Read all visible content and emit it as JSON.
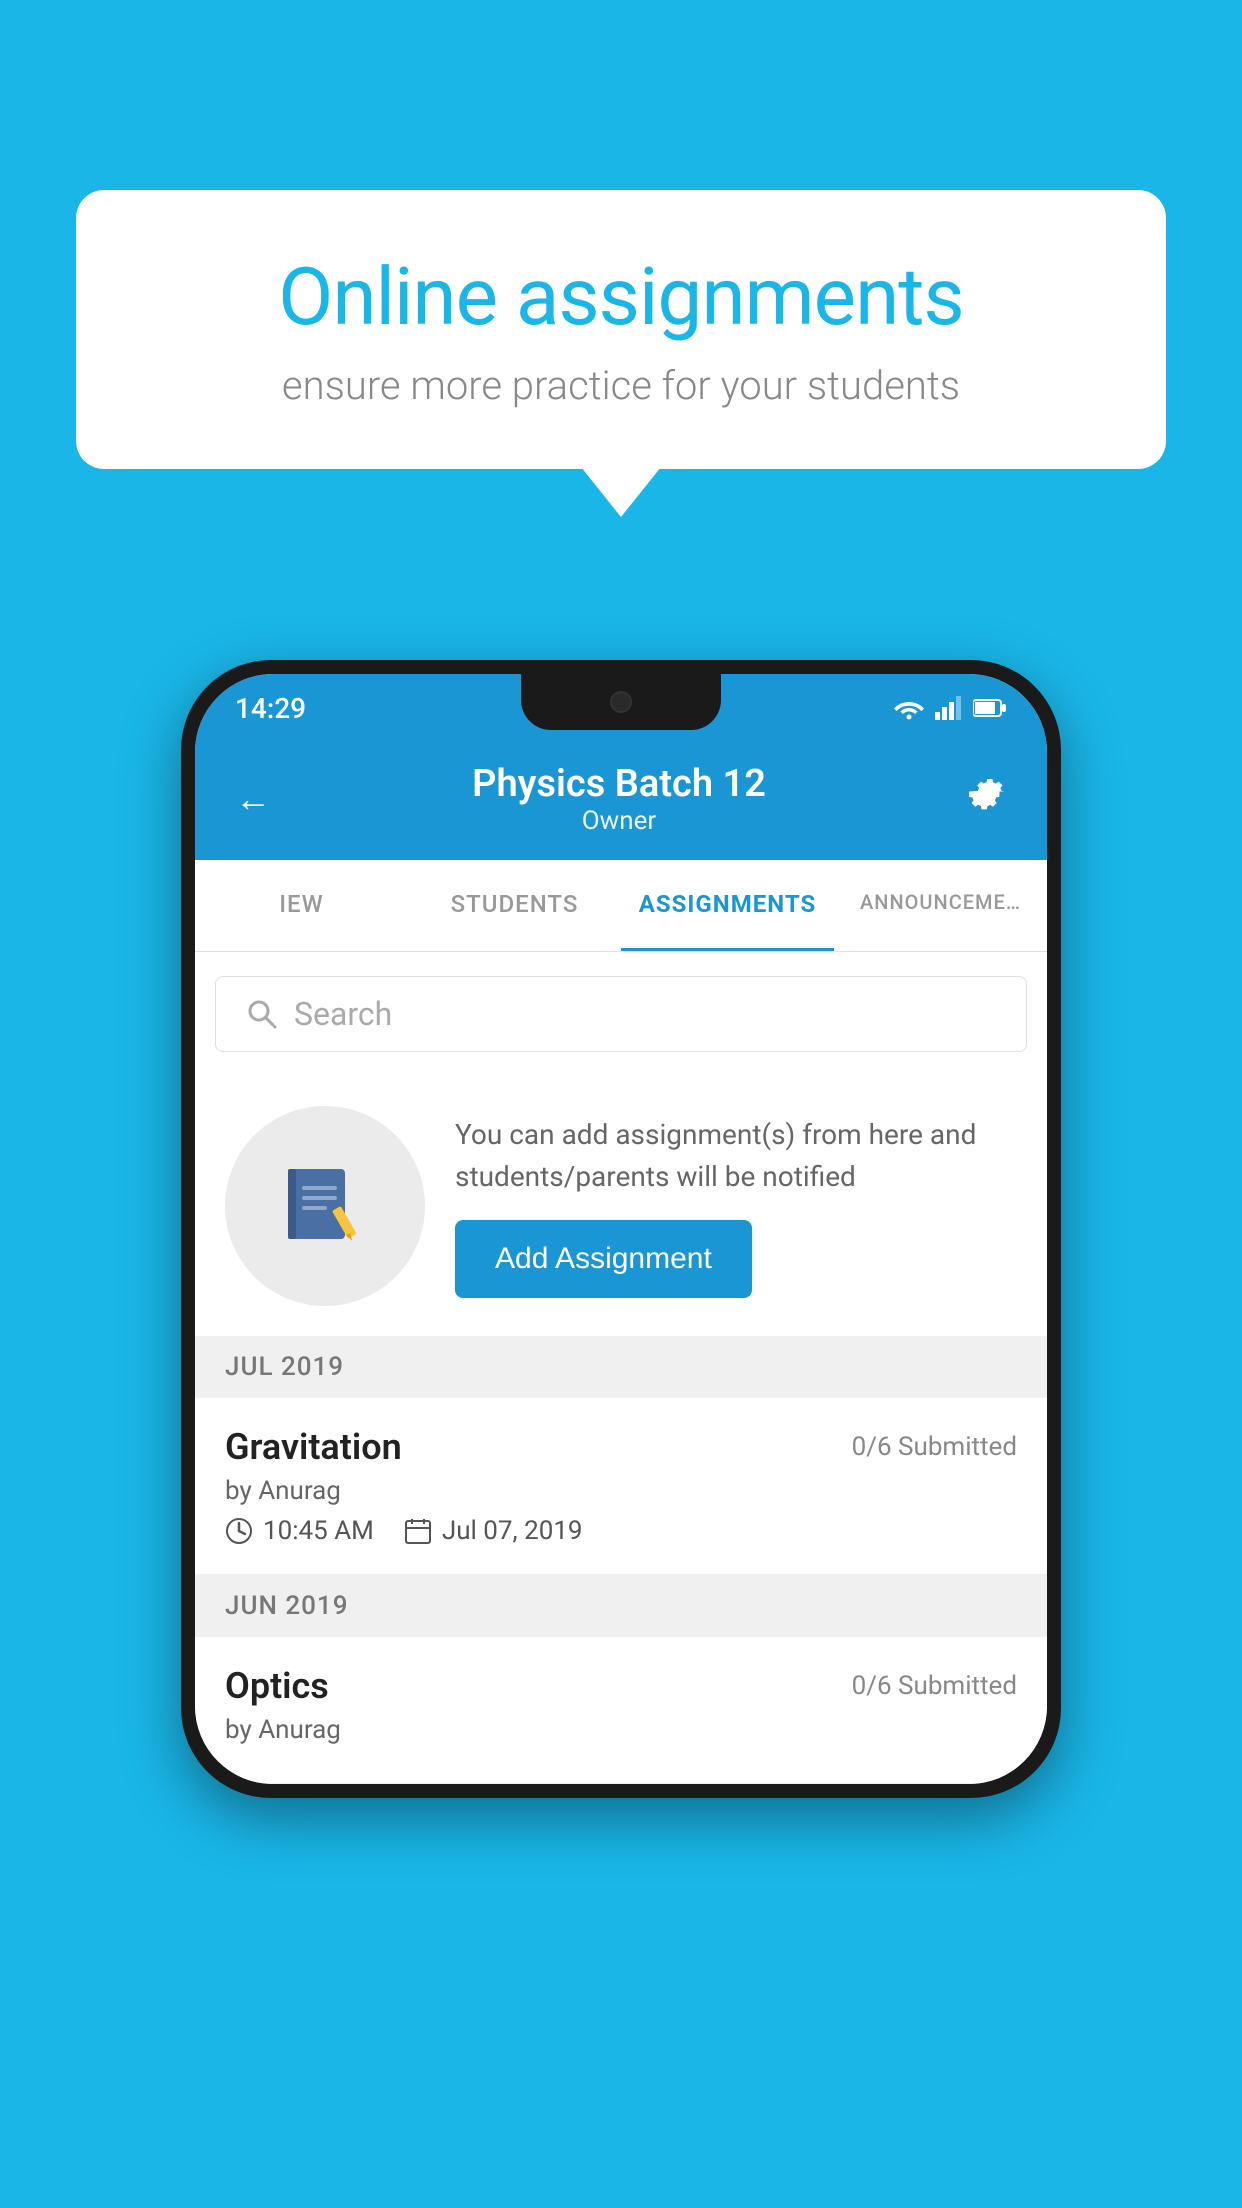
{
  "background_color": "#1ab6e8",
  "speech_bubble": {
    "title": "Online assignments",
    "subtitle": "ensure more practice for your students"
  },
  "status_bar": {
    "time": "14:29",
    "wifi_icon": "wifi",
    "signal_icon": "signal",
    "battery_icon": "battery"
  },
  "header": {
    "title": "Physics Batch 12",
    "subtitle": "Owner",
    "back_label": "←",
    "settings_label": "⚙"
  },
  "tabs": [
    {
      "label": "IEW",
      "active": false
    },
    {
      "label": "STUDENTS",
      "active": false
    },
    {
      "label": "ASSIGNMENTS",
      "active": true
    },
    {
      "label": "ANNOUNCEMENTS",
      "active": false
    }
  ],
  "search": {
    "placeholder": "Search"
  },
  "promo": {
    "text": "You can add assignment(s) from here and students/parents will be notified",
    "button_label": "Add Assignment"
  },
  "sections": [
    {
      "header": "JUL 2019",
      "assignments": [
        {
          "name": "Gravitation",
          "submitted": "0/6 Submitted",
          "author": "by Anurag",
          "time": "10:45 AM",
          "date": "Jul 07, 2019"
        }
      ]
    },
    {
      "header": "JUN 2019",
      "assignments": [
        {
          "name": "Optics",
          "submitted": "0/6 Submitted",
          "author": "by Anurag",
          "time": "",
          "date": ""
        }
      ]
    }
  ]
}
